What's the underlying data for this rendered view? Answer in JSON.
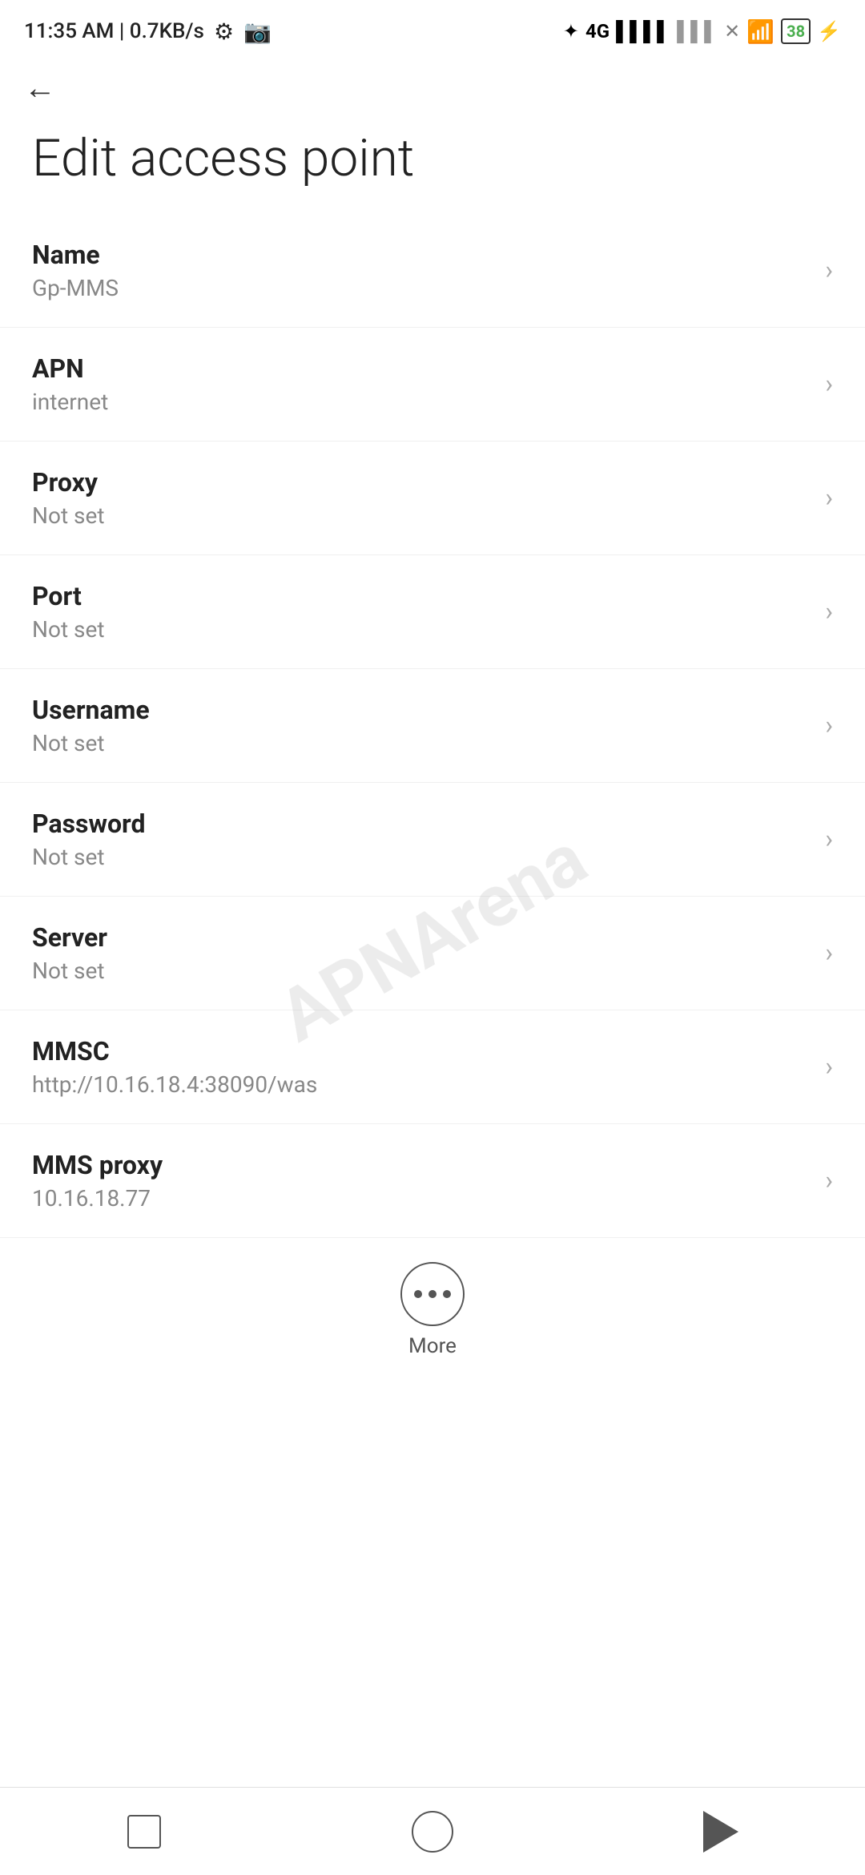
{
  "statusBar": {
    "time": "11:35 AM | 0.7KB/s",
    "battery": "38"
  },
  "header": {
    "backLabel": "←",
    "title": "Edit access point"
  },
  "watermark": "APNArena",
  "settings": [
    {
      "id": "name",
      "label": "Name",
      "value": "Gp-MMS"
    },
    {
      "id": "apn",
      "label": "APN",
      "value": "internet"
    },
    {
      "id": "proxy",
      "label": "Proxy",
      "value": "Not set"
    },
    {
      "id": "port",
      "label": "Port",
      "value": "Not set"
    },
    {
      "id": "username",
      "label": "Username",
      "value": "Not set"
    },
    {
      "id": "password",
      "label": "Password",
      "value": "Not set"
    },
    {
      "id": "server",
      "label": "Server",
      "value": "Not set"
    },
    {
      "id": "mmsc",
      "label": "MMSC",
      "value": "http://10.16.18.4:38090/was"
    },
    {
      "id": "mms-proxy",
      "label": "MMS proxy",
      "value": "10.16.18.77"
    }
  ],
  "more": {
    "label": "More"
  },
  "navbar": {
    "square": "recent-apps",
    "circle": "home",
    "triangle": "back"
  }
}
